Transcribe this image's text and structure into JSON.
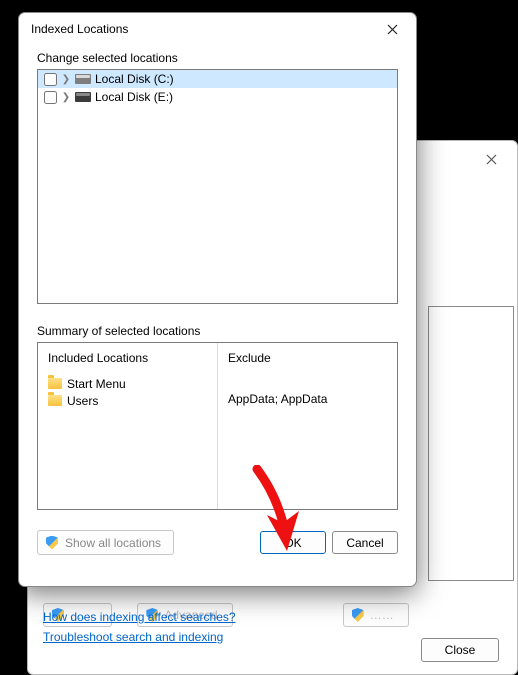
{
  "dialog": {
    "title": "Indexed Locations",
    "change_label": "Change selected locations",
    "tree": [
      {
        "label": "Local Disk (C:)",
        "selected": true,
        "variant": "light"
      },
      {
        "label": "Local Disk (E:)",
        "selected": false,
        "variant": "dark"
      }
    ],
    "summary_label": "Summary of selected locations",
    "included_header": "Included Locations",
    "exclude_header": "Exclude",
    "included": [
      {
        "label": "Start Menu"
      },
      {
        "label": "Users"
      }
    ],
    "exclude_text": "AppData; AppData",
    "show_all": "Show all locations",
    "ok": "OK",
    "cancel": "Cancel"
  },
  "bg": {
    "stub1": "…….",
    "stub2": "Advanced",
    "stub3": "……",
    "link1": "How does indexing affect searches?",
    "link2": "Troubleshoot search and indexing",
    "close": "Close"
  }
}
